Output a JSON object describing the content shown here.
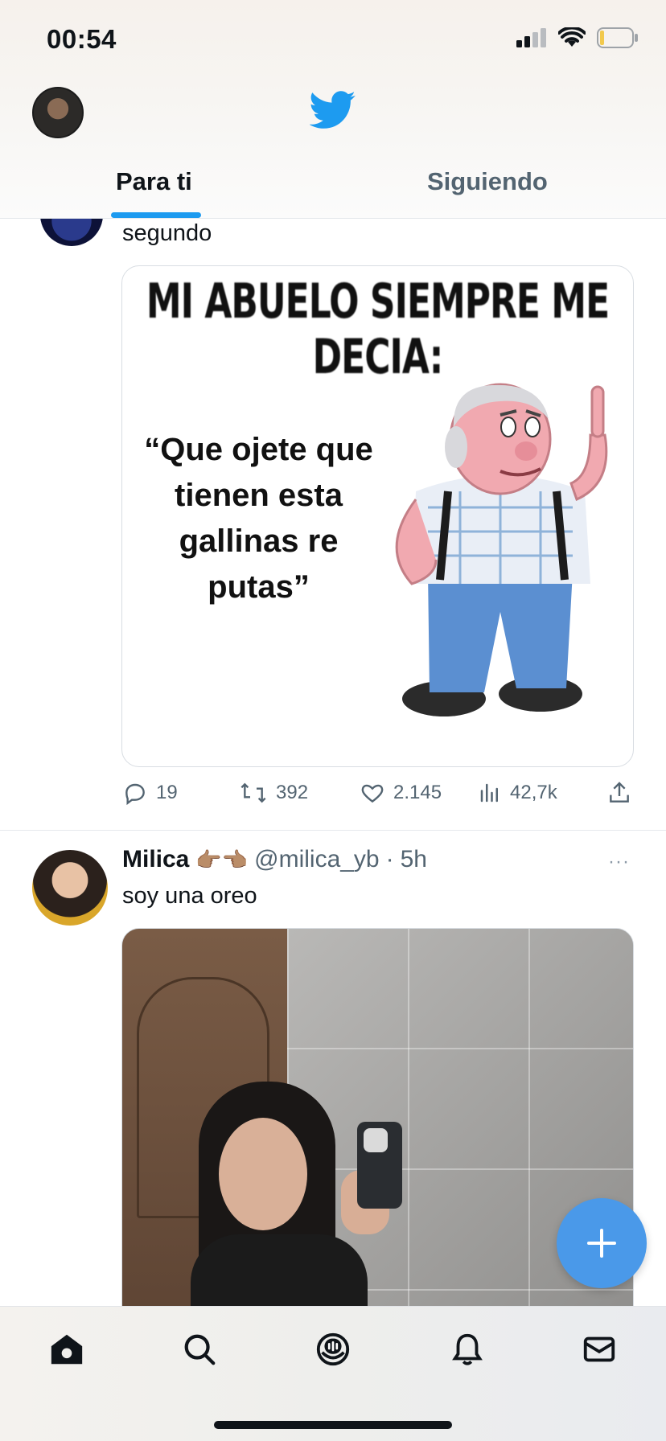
{
  "status_bar": {
    "time": "00:54",
    "icons": [
      "cellular-signal-icon",
      "wifi-icon",
      "battery-icon"
    ]
  },
  "header": {
    "logo": "twitter-bird-icon",
    "tabs": [
      {
        "label": "Para ti",
        "active": true
      },
      {
        "label": "Siguiendo",
        "active": false
      }
    ]
  },
  "feed": {
    "tweets": [
      {
        "text": "segundo",
        "media": {
          "meme_title": "MI ABUELO SIEMPRE ME DECIA:",
          "meme_quote": "“Que ojete que tienen esta gallinas re putas”"
        },
        "stats": {
          "replies": "19",
          "retweets": "392",
          "likes": "2.145",
          "views": "42,7k"
        }
      },
      {
        "author_name": "Milica",
        "author_emoji": "👉🏽👈🏽",
        "handle": "@milica_yb",
        "separator": "·",
        "time": "5h",
        "more": "···",
        "text": "soy una oreo"
      }
    ]
  },
  "fab": {
    "label": "+"
  },
  "bottom_nav": {
    "items": [
      "home-icon",
      "search-icon",
      "spaces-icon",
      "notifications-icon",
      "messages-icon"
    ]
  },
  "colors": {
    "accent": "#1d9bf0",
    "fab": "#4a99e9",
    "secondary_text": "#536471"
  }
}
